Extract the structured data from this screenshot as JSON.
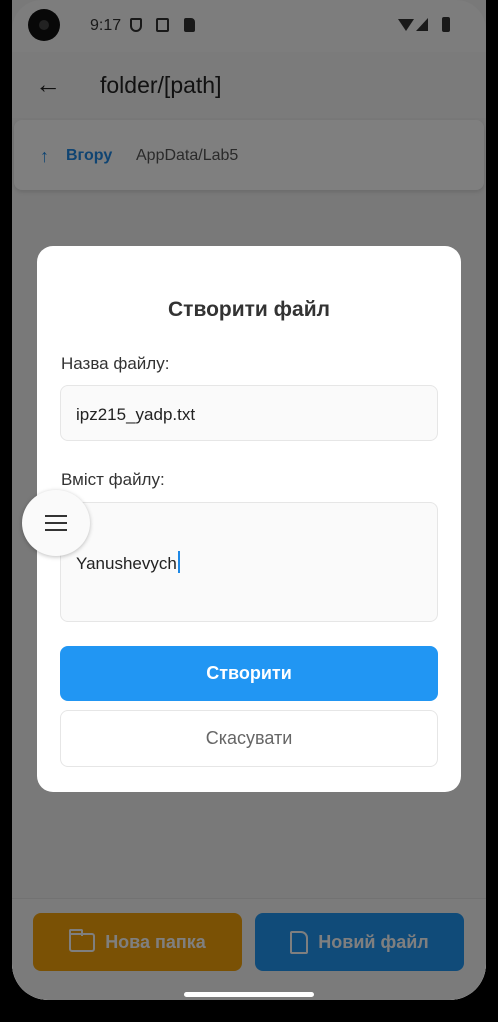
{
  "status_bar": {
    "time": "9:17"
  },
  "app_bar": {
    "title": "folder/[path]"
  },
  "path_card": {
    "up_icon": "↑",
    "up_label": "Вгору",
    "path": "AppData/Lab5"
  },
  "bottom_bar": {
    "new_folder_label": "Нова папка",
    "new_file_label": "Новий файл"
  },
  "dialog": {
    "title": "Створити файл",
    "name_label": "Назва файлу:",
    "name_value": "ipz215_yadp.txt",
    "content_label": "Вміст файлу:",
    "content_value": "Yanushevych",
    "create_label": "Створити",
    "cancel_label": "Скасувати"
  },
  "icons": {
    "back": "arrow-left-icon",
    "up": "arrow-up-icon",
    "folder": "folder-icon",
    "file": "file-icon",
    "menu": "menu-icon"
  },
  "colors": {
    "primary_blue": "#2196f3",
    "folder_orange": "#f5a20a",
    "link_blue": "#1e88e5"
  }
}
